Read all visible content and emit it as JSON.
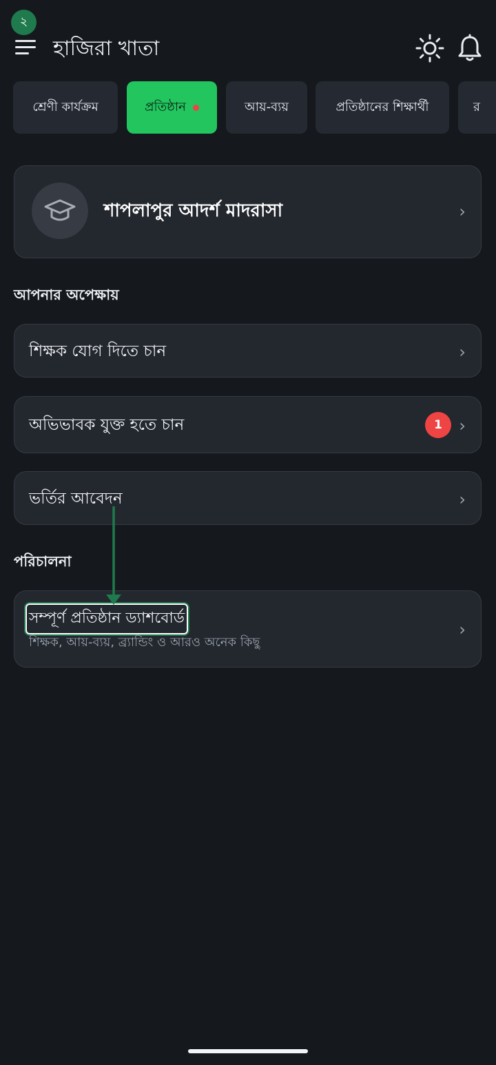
{
  "overlay": {
    "step_label": "২"
  },
  "header": {
    "title": "হাজিরা খাতা"
  },
  "icons": {
    "menu": "menu-icon",
    "theme": "sun-icon",
    "notifications": "bell-icon",
    "institution": "graduation-cap-icon",
    "chevron": "chevron-right-icon"
  },
  "tabs": [
    {
      "label": "শ্রেণী কার্যক্রম",
      "active": false
    },
    {
      "label": "প্রতিষ্ঠান",
      "active": true,
      "has_dot": true
    },
    {
      "label": "আয়-ব্যয়",
      "active": false
    },
    {
      "label": "প্রতিষ্ঠানের শিক্ষার্থী",
      "active": false
    },
    {
      "label": "র",
      "active": false
    }
  ],
  "institution": {
    "name": "শাপলাপুর আদর্শ মাদরাসা",
    "chevron": "›"
  },
  "pending": {
    "heading": "আপনার অপেক্ষায়",
    "items": [
      {
        "label": "শিক্ষক যোগ দিতে চান",
        "chevron": "›"
      },
      {
        "label": "অভিভাবক যুক্ত হতে চান",
        "badge": "1",
        "chevron": "›"
      },
      {
        "label": "ভর্তির আবেদন",
        "chevron": "›"
      }
    ]
  },
  "management": {
    "heading": "পরিচালনা",
    "dashboard": {
      "title": "সম্পূর্ণ প্রতিষ্ঠান ড্যাশবোর্ড",
      "subtitle": "শিক্ষক, আয়-ব্যয়, ব্র্যান্ডিং ও আরও অনেক কিছু",
      "chevron": "›"
    }
  },
  "colors": {
    "accent": "#22c55e",
    "background": "#15181d",
    "card": "#23272e",
    "badge": "#ef4444",
    "annotation": "#1f7a4d"
  }
}
